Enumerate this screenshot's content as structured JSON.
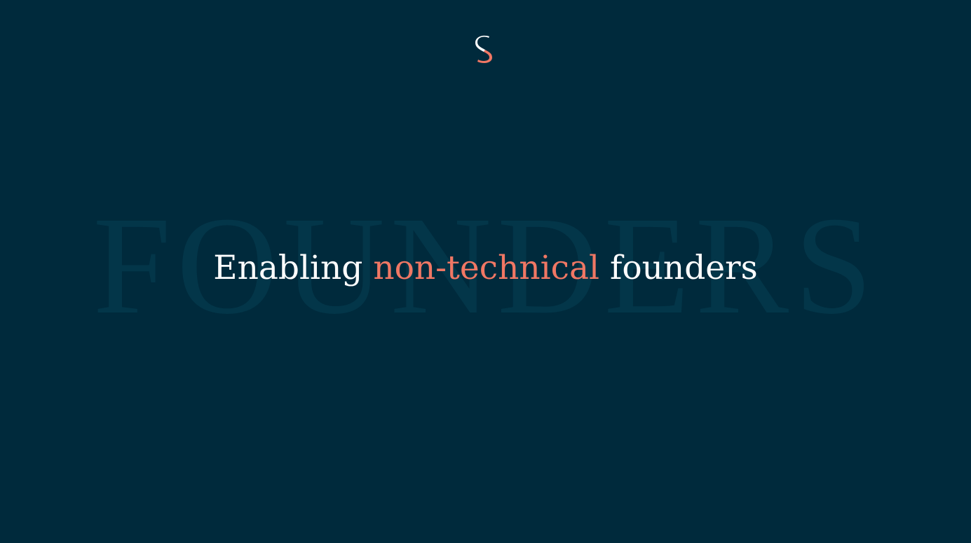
{
  "colors": {
    "background": "#002a3c",
    "accent": "#f07764",
    "text": "#ffffff",
    "watermark": "#033649"
  },
  "brand": {
    "logo_icon": "s-logo-icon"
  },
  "hero": {
    "watermark": "FOUNDERS",
    "headline_part_1": "Enabling ",
    "headline_highlight": "non-technical",
    "headline_part_2": " founders"
  }
}
